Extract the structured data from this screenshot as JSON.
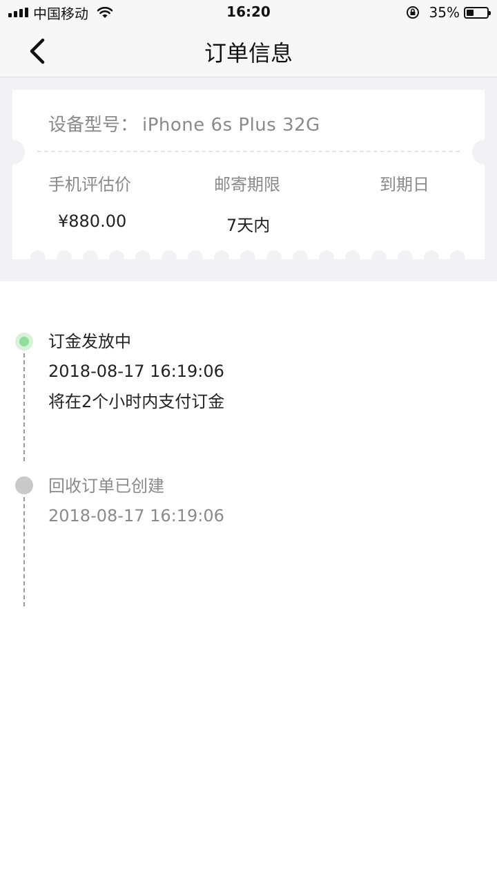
{
  "status_bar": {
    "carrier": "中国移动",
    "time": "16:20",
    "battery_percent": "35%",
    "battery_level": 0.35
  },
  "nav": {
    "title": "订单信息"
  },
  "ticket": {
    "model_label": "设备型号：",
    "model_value": "iPhone 6s Plus  32G",
    "columns": [
      {
        "label": "手机评估价",
        "value": "¥880.00"
      },
      {
        "label": "邮寄期限",
        "value": "7天内"
      },
      {
        "label": "到期日",
        "value": ""
      }
    ]
  },
  "timeline": [
    {
      "status": "active",
      "title": "订金发放中",
      "time": "2018-08-17 16:19:06",
      "note": "将在2个小时内支付订金"
    },
    {
      "status": "inactive",
      "title": "回收订单已创建",
      "time": "2018-08-17 16:19:06"
    }
  ],
  "colors": {
    "active_dot": "#8fdf9a",
    "inactive_dot": "#c9c9c9",
    "background_gray": "#f2f2f4"
  }
}
